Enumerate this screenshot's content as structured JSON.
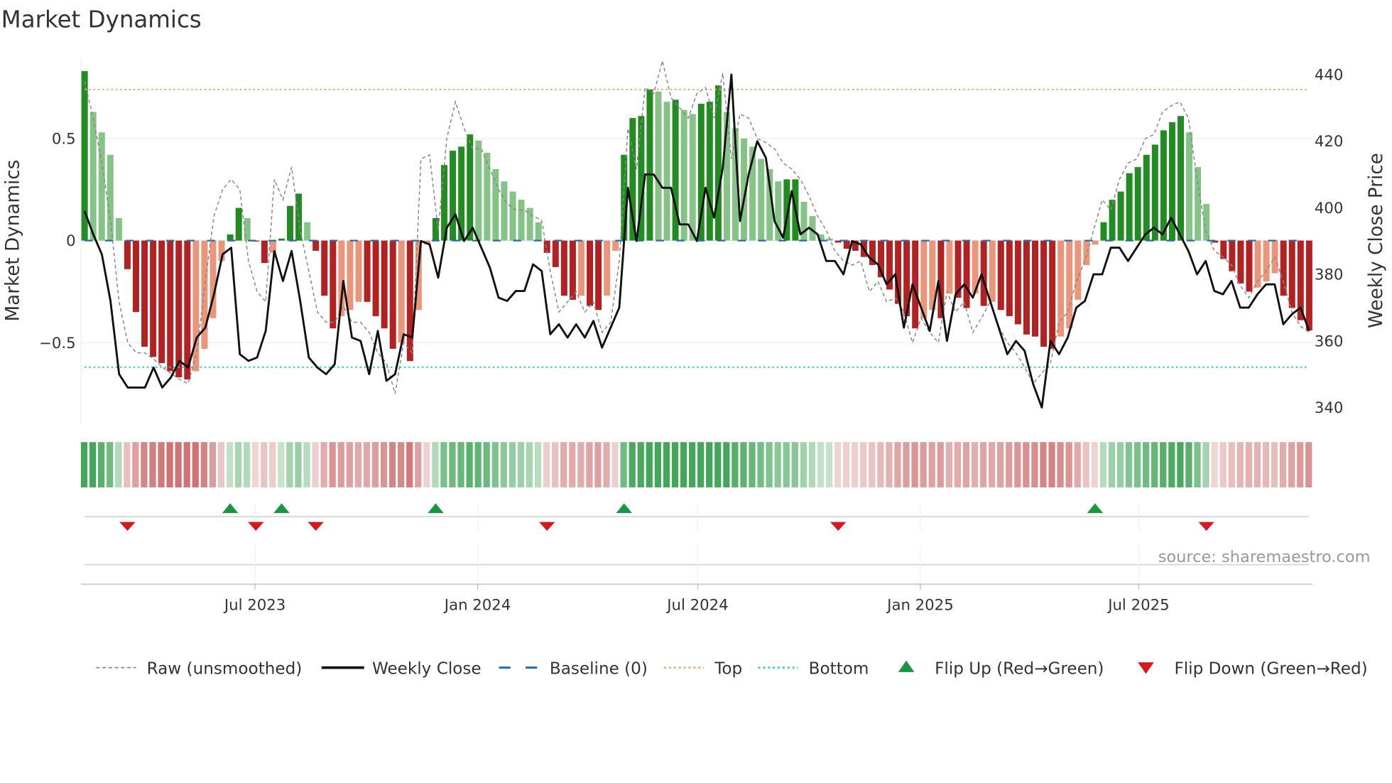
{
  "title": "Market Dynamics",
  "source": "source: sharemaestro.com",
  "colors": {
    "dark_green": "#228b22",
    "light_green": "#86c386",
    "dark_red": "#b22222",
    "light_red": "#e9967a",
    "top": "#f0a868",
    "bottom": "#2ec6d6",
    "baseline": "#1f6fb0",
    "flip_up": "#1a9641",
    "flip_down": "#d7191c",
    "close": "#111111",
    "raw": "#888888"
  },
  "chart_data": {
    "type": "bar",
    "title": "Market Dynamics",
    "ylabel": "Market Dynamics",
    "y2label": "Weekly Close Price",
    "ylim": [
      -0.9,
      0.9
    ],
    "y2lim": [
      336,
      445
    ],
    "y_ticks": [
      {
        "v": 0.5,
        "label": "0.5"
      },
      {
        "v": 0,
        "label": "0"
      },
      {
        "v": -0.5,
        "label": "−0.5"
      }
    ],
    "y2_ticks": [
      {
        "v": 440,
        "label": "440"
      },
      {
        "v": 420,
        "label": "420"
      },
      {
        "v": 400,
        "label": "400"
      },
      {
        "v": 380,
        "label": "380"
      },
      {
        "v": 360,
        "label": "360"
      },
      {
        "v": 340,
        "label": "340"
      }
    ],
    "x_ticks": [
      {
        "week": 19.9,
        "label": "Jul 2023"
      },
      {
        "week": 45.9,
        "label": "Jan 2024"
      },
      {
        "week": 71.6,
        "label": "Jul 2024"
      },
      {
        "week": 97.6,
        "label": "Jan 2025"
      },
      {
        "week": 123.1,
        "label": "Jul 2025"
      }
    ],
    "top": 0.74,
    "bottom": -0.62,
    "baseline": 0,
    "momentum": [
      0.83,
      0.63,
      0.53,
      0.42,
      0.11,
      -0.14,
      -0.35,
      -0.52,
      -0.57,
      -0.6,
      -0.64,
      -0.67,
      -0.68,
      -0.64,
      -0.53,
      -0.38,
      -0.1,
      0.03,
      0.16,
      0.11,
      -0.005,
      -0.11,
      -0.06,
      0.01,
      0.17,
      0.23,
      0.09,
      -0.05,
      -0.27,
      -0.43,
      -0.37,
      -0.34,
      -0.3,
      -0.3,
      -0.37,
      -0.43,
      -0.53,
      -0.5,
      -0.59,
      -0.34,
      -0.02,
      0.11,
      0.37,
      0.44,
      0.46,
      0.52,
      0.49,
      0.43,
      0.35,
      0.29,
      0.24,
      0.2,
      0.16,
      0.09,
      -0.06,
      -0.13,
      -0.27,
      -0.29,
      -0.27,
      -0.32,
      -0.34,
      -0.27,
      -0.05,
      0.42,
      0.6,
      0.61,
      0.74,
      0.73,
      0.68,
      0.69,
      0.64,
      0.62,
      0.67,
      0.68,
      0.76,
      0.63,
      0.55,
      0.5,
      0.46,
      0.4,
      0.35,
      0.29,
      0.3,
      0.3,
      0.19,
      0.12,
      0.03,
      0.01,
      -0.01,
      -0.04,
      -0.05,
      -0.08,
      -0.12,
      -0.18,
      -0.24,
      -0.31,
      -0.37,
      -0.43,
      -0.38,
      -0.34,
      -0.38,
      -0.26,
      -0.28,
      -0.33,
      -0.26,
      -0.32,
      -0.3,
      -0.34,
      -0.37,
      -0.41,
      -0.46,
      -0.47,
      -0.52,
      -0.53,
      -0.47,
      -0.43,
      -0.29,
      -0.12,
      -0.02,
      0.09,
      0.2,
      0.24,
      0.33,
      0.36,
      0.42,
      0.47,
      0.54,
      0.58,
      0.61,
      0.53,
      0.36,
      0.18,
      -0.01,
      -0.09,
      -0.15,
      -0.21,
      -0.25,
      -0.23,
      -0.2,
      -0.16,
      -0.27,
      -0.33,
      -0.39,
      -0.44
    ],
    "raw": [
      0.78,
      0.6,
      0.38,
      0.1,
      -0.3,
      -0.5,
      -0.55,
      -0.55,
      -0.58,
      -0.62,
      -0.65,
      -0.68,
      -0.7,
      -0.55,
      -0.2,
      0.12,
      0.25,
      0.3,
      0.25,
      -0.1,
      -0.25,
      -0.3,
      0.3,
      0.2,
      0.36,
      0.05,
      -0.15,
      -0.35,
      -0.4,
      -0.4,
      -0.32,
      -0.4,
      -0.4,
      -0.45,
      -0.55,
      -0.6,
      -0.75,
      -0.5,
      -0.55,
      0.4,
      0.42,
      0.05,
      0.5,
      0.68,
      0.55,
      0.45,
      0.45,
      0.35,
      0.25,
      0.18,
      0.15,
      0.15,
      0.12,
      0.1,
      -0.15,
      -0.35,
      -0.3,
      -0.25,
      -0.35,
      -0.3,
      -0.45,
      -0.4,
      -0.1,
      0.55,
      0.35,
      0.75,
      0.72,
      0.88,
      0.7,
      0.65,
      0.6,
      0.72,
      0.75,
      0.6,
      0.82,
      0.4,
      0.62,
      0.6,
      0.5,
      0.48,
      0.45,
      0.38,
      0.35,
      0.3,
      0.22,
      0.12,
      0.05,
      -0.05,
      -0.1,
      -0.12,
      -0.1,
      -0.25,
      -0.2,
      -0.3,
      -0.28,
      -0.35,
      -0.5,
      -0.38,
      -0.45,
      -0.5,
      -0.25,
      -0.35,
      -0.3,
      -0.45,
      -0.38,
      -0.3,
      -0.42,
      -0.5,
      -0.55,
      -0.62,
      -0.7,
      -0.65,
      -0.6,
      -0.4,
      -0.35,
      -0.2,
      -0.1,
      0.05,
      0.2,
      0.15,
      0.3,
      0.38,
      0.4,
      0.5,
      0.52,
      0.63,
      0.66,
      0.68,
      0.6,
      0.3,
      0.05,
      -0.05,
      -0.08,
      -0.12,
      -0.22,
      -0.28,
      -0.2,
      -0.15,
      -0.08,
      -0.2,
      -0.35,
      -0.42,
      -0.45
    ],
    "close": [
      399,
      392,
      386,
      372,
      350,
      346,
      346,
      346,
      352,
      346,
      349,
      354,
      352,
      361,
      364,
      374,
      386,
      388,
      356,
      354,
      355,
      363,
      387,
      378,
      387,
      372,
      355,
      352,
      350,
      353,
      378,
      361,
      360,
      350,
      363,
      348,
      350,
      362,
      361,
      390,
      389,
      379,
      394,
      398,
      390,
      394,
      388,
      382,
      373,
      372,
      375,
      375,
      383,
      381,
      362,
      365,
      361,
      365,
      361,
      366,
      358,
      364,
      370,
      406,
      390,
      410,
      410,
      406,
      406,
      395,
      395,
      390,
      406,
      397,
      412,
      440,
      396,
      410,
      420,
      415,
      396,
      391,
      405,
      392,
      394,
      392,
      384,
      384,
      380,
      390,
      389,
      385,
      383,
      377,
      380,
      364,
      377,
      370,
      363,
      378,
      360,
      374,
      377,
      373,
      380,
      372,
      364,
      356,
      360,
      357,
      347,
      340,
      360,
      356,
      361,
      370,
      372,
      380,
      380,
      388,
      388,
      384,
      388,
      392,
      394,
      392,
      397,
      392,
      387,
      380,
      384,
      375,
      374,
      378,
      370,
      370,
      374,
      377,
      377,
      365,
      368,
      370,
      363
    ],
    "flip_up_weeks": [
      17,
      23,
      41,
      63,
      118
    ],
    "flip_down_weeks": [
      5,
      20,
      27,
      54,
      88,
      131
    ],
    "legend": [
      {
        "label": "Raw (unsmoothed)",
        "kind": "raw"
      },
      {
        "label": "Weekly Close",
        "kind": "close"
      },
      {
        "label": "Baseline (0)",
        "kind": "baseline"
      },
      {
        "label": "Top",
        "kind": "top"
      },
      {
        "label": "Bottom",
        "kind": "bottom"
      },
      {
        "label": "Flip Up (Red→Green)",
        "kind": "up"
      },
      {
        "label": "Flip Down (Green→Red)",
        "kind": "down"
      }
    ]
  }
}
